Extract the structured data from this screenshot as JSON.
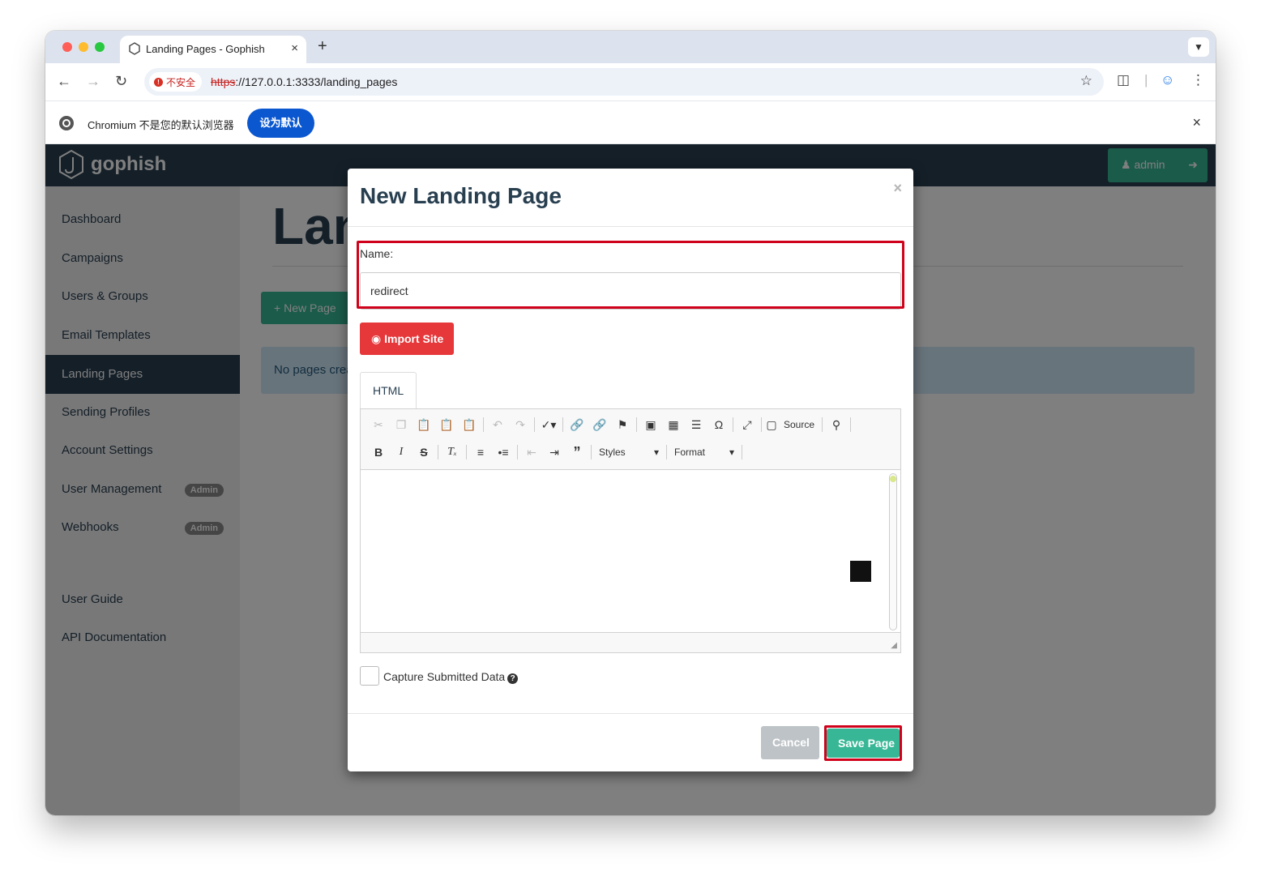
{
  "browser": {
    "tab_title": "Landing Pages - Gophish",
    "tab_close": "×",
    "new_tab": "+",
    "security_label": "不安全",
    "url_scheme": "https",
    "url_rest": "://127.0.0.1:3333/landing_pages",
    "infobar_text": "Chromium 不是您的默认浏览器",
    "infobar_button": "设为默认",
    "infobar_close": "×"
  },
  "app": {
    "brand": "gophish",
    "user_label": "admin",
    "page_title": "Lan",
    "new_page_button": "New Page",
    "alert_text": "No pages crea"
  },
  "sidebar": {
    "items": [
      {
        "label": "Dashboard"
      },
      {
        "label": "Campaigns"
      },
      {
        "label": "Users & Groups"
      },
      {
        "label": "Email Templates"
      },
      {
        "label": "Landing Pages",
        "active": true
      },
      {
        "label": "Sending Profiles"
      },
      {
        "label": "Account Settings"
      },
      {
        "label": "User Management",
        "badge": "Admin"
      },
      {
        "label": "Webhooks",
        "badge": "Admin"
      },
      {
        "label": "User Guide"
      },
      {
        "label": "API Documentation"
      }
    ]
  },
  "modal": {
    "title": "New Landing Page",
    "close": "×",
    "name_label": "Name:",
    "name_value": "redirect",
    "import_button": "Import Site",
    "tab_label": "HTML",
    "source_label": "Source",
    "styles_label": "Styles",
    "format_label": "Format",
    "capture_label": "Capture Submitted Data",
    "cancel_button": "Cancel",
    "save_button": "Save Page"
  },
  "colors": {
    "navbar": "#283f50",
    "primary_green": "#37b795",
    "danger_red": "#e6373a",
    "highlight": "#d0021b"
  }
}
